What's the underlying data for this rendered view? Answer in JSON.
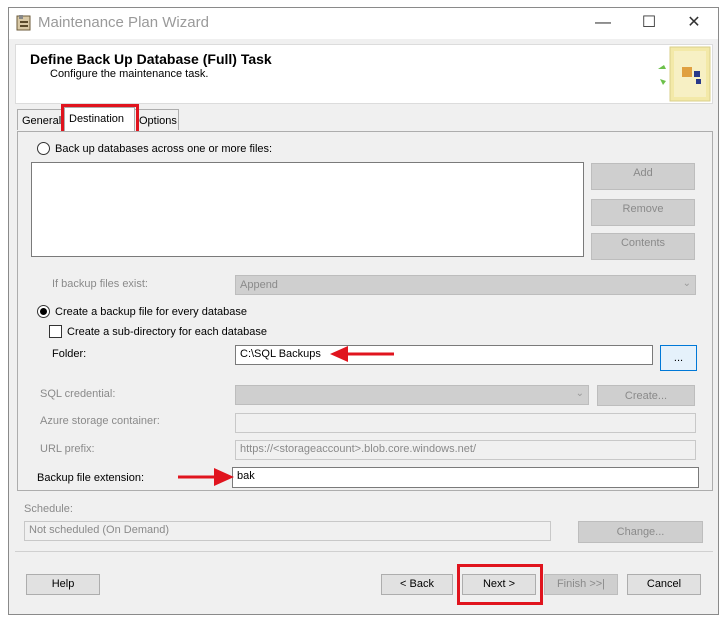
{
  "window": {
    "title": "Maintenance Plan Wizard",
    "minimize_icon": "minimize-icon",
    "maximize_icon": "maximize-icon",
    "close_icon": "close-icon"
  },
  "header": {
    "title": "Define Back Up Database (Full) Task",
    "subtitle": "Configure the maintenance task."
  },
  "tabs": [
    {
      "label": "General",
      "selected": false
    },
    {
      "label": "Destination",
      "selected": true
    },
    {
      "label": "Options",
      "selected": false
    }
  ],
  "destination": {
    "across_files_label": "Back up databases across one or more files:",
    "add_label": "Add",
    "remove_label": "Remove",
    "contents_label": "Contents",
    "if_exist_label": "If backup files exist:",
    "if_exist_value": "Append",
    "create_per_db_label": "Create a backup file for every database",
    "subdir_label": "Create a sub-directory for each database",
    "folder_label": "Folder:",
    "folder_value": "C:\\SQL Backups",
    "browse_label": "...",
    "credential_label": "SQL credential:",
    "create_label": "Create...",
    "azure_label": "Azure storage container:",
    "url_label": "URL prefix:",
    "url_value": "https://<storageaccount>.blob.core.windows.net/",
    "ext_label": "Backup file extension:",
    "ext_value": "bak"
  },
  "schedule": {
    "label": "Schedule:",
    "value": "Not scheduled (On Demand)",
    "change_label": "Change..."
  },
  "footer": {
    "help": "Help",
    "back": "< Back",
    "next": "Next >",
    "finish": "Finish >>|",
    "cancel": "Cancel"
  },
  "colors": {
    "annotation_red": "#e0141e",
    "focus_blue": "#0078d7"
  }
}
